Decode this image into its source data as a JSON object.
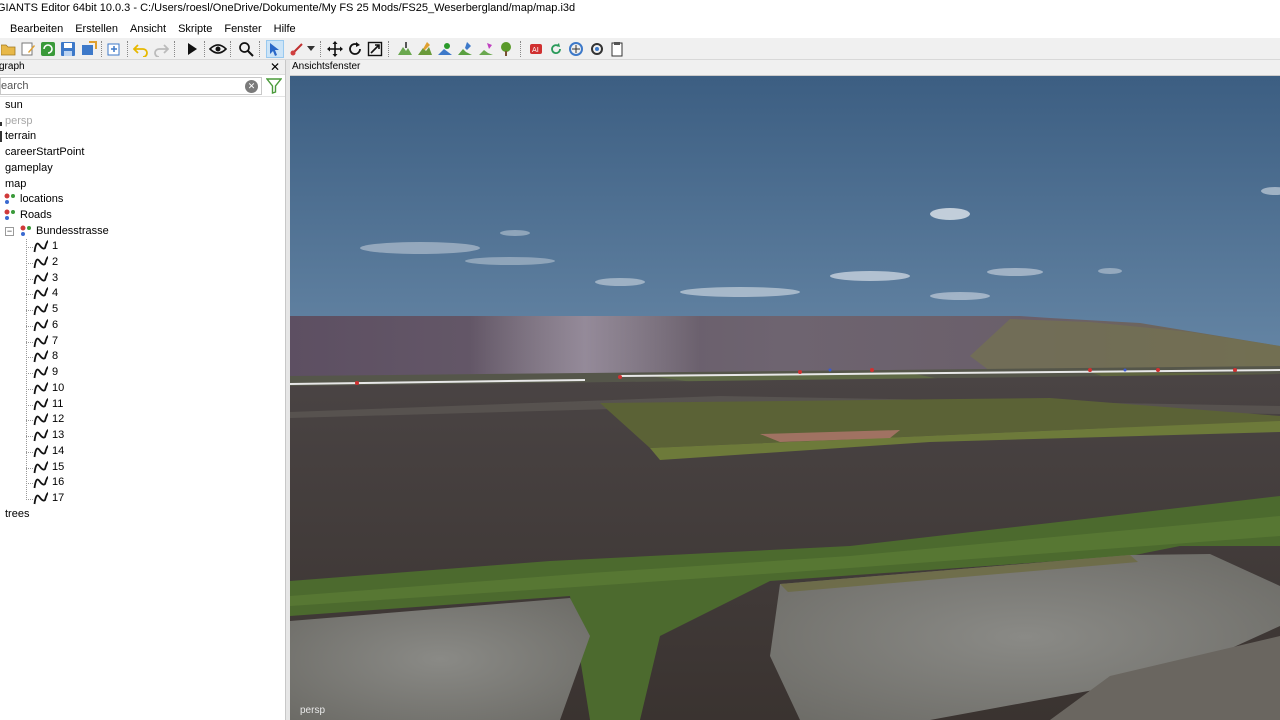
{
  "window": {
    "title": "GIANTS Editor 64bit 10.0.3 - C:/Users/roesl/OneDrive/Dokumente/My FS 25 Mods/FS25_Weserbergland/map/map.i3d"
  },
  "menu": {
    "items": [
      "Bearbeiten",
      "Erstellen",
      "Ansicht",
      "Skripte",
      "Fenster",
      "Hilfe"
    ]
  },
  "scenegraph": {
    "title": "graph",
    "close_label": "✕",
    "search_placeholder": "earch",
    "nodes": {
      "sun": "sun",
      "persp": "persp",
      "terrain": "terrain",
      "careerStartPoint": "careerStartPoint",
      "gameplay": "gameplay",
      "map": "map",
      "locations": "locations",
      "roads": "Roads",
      "bundesstrasse": "Bundesstrasse",
      "trees": "trees"
    },
    "splines": [
      "1",
      "2",
      "3",
      "4",
      "5",
      "6",
      "7",
      "8",
      "9",
      "10",
      "11",
      "12",
      "13",
      "14",
      "15",
      "16",
      "17"
    ]
  },
  "viewport": {
    "title": "Ansichtsfenster",
    "camera": "persp"
  },
  "colors": {
    "accent": "#0078d7",
    "active_tool": "#cce4f7"
  }
}
